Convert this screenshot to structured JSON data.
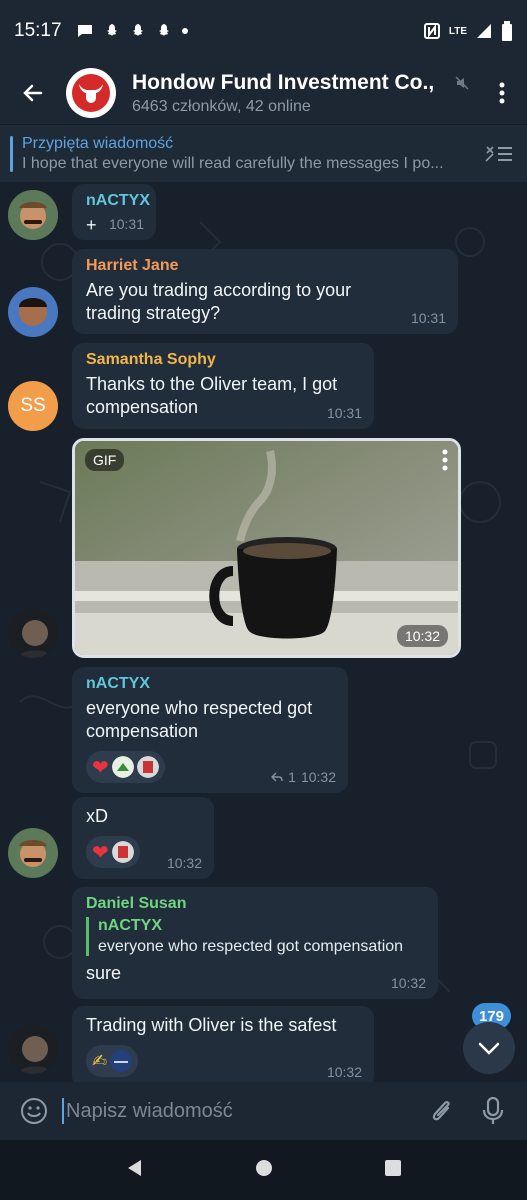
{
  "status_bar": {
    "time": "15:17",
    "network": "LTE"
  },
  "header": {
    "title": "Hondow Fund Investment Co.,",
    "subtitle": "6463 członków, 42 online"
  },
  "pinned": {
    "title": "Przypięta wiadomość",
    "message": "I hope that everyone will read carefully the messages I po..."
  },
  "messages": [
    {
      "sender": "nACTYX",
      "sender_color": "#5fc7d9",
      "text": "+",
      "time": "10:31"
    },
    {
      "sender": "Harriet Jane",
      "sender_color": "#f39a5a",
      "text": "Are you trading according to your trading strategy?",
      "time": "10:31"
    },
    {
      "sender": "Samantha Sophy",
      "sender_color": "#f2b646",
      "avatar_initials": "SS",
      "text": "Thanks to the Oliver team, I got compensation",
      "time": "10:31"
    },
    {
      "gif_label": "GIF",
      "time": "10:32"
    },
    {
      "sender": "nACTYX",
      "sender_color": "#5fc7d9",
      "text": "everyone who respected got compensation",
      "reply_count": "1",
      "time": "10:32"
    },
    {
      "text": "xD",
      "time": "10:32"
    },
    {
      "sender": "Daniel Susan",
      "sender_color": "#6fd57f",
      "reply_to_name": "nACTYX",
      "reply_to_text": "everyone who respected got compensation",
      "text": "sure",
      "time": "10:32"
    },
    {
      "text": "Trading with Oliver is the safest",
      "time": "10:32"
    }
  ],
  "unread_count": "179",
  "composer": {
    "placeholder": "Napisz wiadomość"
  }
}
